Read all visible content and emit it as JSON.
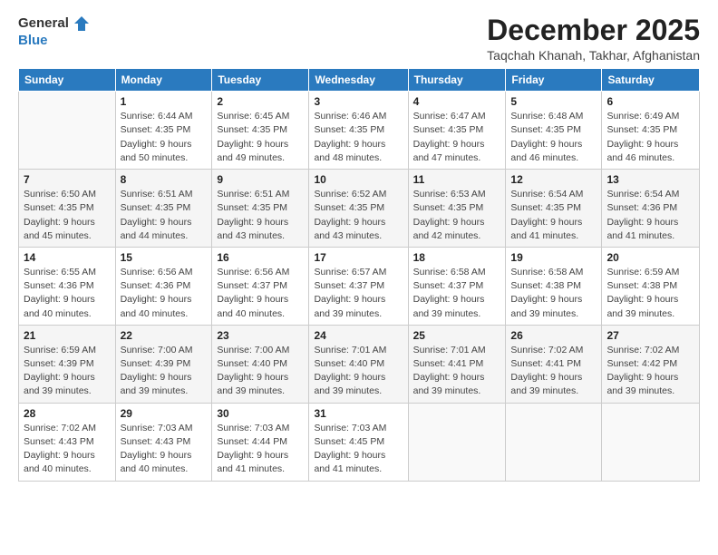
{
  "header": {
    "logo_general": "General",
    "logo_blue": "Blue",
    "month": "December 2025",
    "location": "Taqchah Khanah, Takhar, Afghanistan"
  },
  "weekdays": [
    "Sunday",
    "Monday",
    "Tuesday",
    "Wednesday",
    "Thursday",
    "Friday",
    "Saturday"
  ],
  "weeks": [
    [
      {
        "day": "",
        "info": ""
      },
      {
        "day": "1",
        "info": "Sunrise: 6:44 AM\nSunset: 4:35 PM\nDaylight: 9 hours\nand 50 minutes."
      },
      {
        "day": "2",
        "info": "Sunrise: 6:45 AM\nSunset: 4:35 PM\nDaylight: 9 hours\nand 49 minutes."
      },
      {
        "day": "3",
        "info": "Sunrise: 6:46 AM\nSunset: 4:35 PM\nDaylight: 9 hours\nand 48 minutes."
      },
      {
        "day": "4",
        "info": "Sunrise: 6:47 AM\nSunset: 4:35 PM\nDaylight: 9 hours\nand 47 minutes."
      },
      {
        "day": "5",
        "info": "Sunrise: 6:48 AM\nSunset: 4:35 PM\nDaylight: 9 hours\nand 46 minutes."
      },
      {
        "day": "6",
        "info": "Sunrise: 6:49 AM\nSunset: 4:35 PM\nDaylight: 9 hours\nand 46 minutes."
      }
    ],
    [
      {
        "day": "7",
        "info": "Sunrise: 6:50 AM\nSunset: 4:35 PM\nDaylight: 9 hours\nand 45 minutes."
      },
      {
        "day": "8",
        "info": "Sunrise: 6:51 AM\nSunset: 4:35 PM\nDaylight: 9 hours\nand 44 minutes."
      },
      {
        "day": "9",
        "info": "Sunrise: 6:51 AM\nSunset: 4:35 PM\nDaylight: 9 hours\nand 43 minutes."
      },
      {
        "day": "10",
        "info": "Sunrise: 6:52 AM\nSunset: 4:35 PM\nDaylight: 9 hours\nand 43 minutes."
      },
      {
        "day": "11",
        "info": "Sunrise: 6:53 AM\nSunset: 4:35 PM\nDaylight: 9 hours\nand 42 minutes."
      },
      {
        "day": "12",
        "info": "Sunrise: 6:54 AM\nSunset: 4:35 PM\nDaylight: 9 hours\nand 41 minutes."
      },
      {
        "day": "13",
        "info": "Sunrise: 6:54 AM\nSunset: 4:36 PM\nDaylight: 9 hours\nand 41 minutes."
      }
    ],
    [
      {
        "day": "14",
        "info": "Sunrise: 6:55 AM\nSunset: 4:36 PM\nDaylight: 9 hours\nand 40 minutes."
      },
      {
        "day": "15",
        "info": "Sunrise: 6:56 AM\nSunset: 4:36 PM\nDaylight: 9 hours\nand 40 minutes."
      },
      {
        "day": "16",
        "info": "Sunrise: 6:56 AM\nSunset: 4:37 PM\nDaylight: 9 hours\nand 40 minutes."
      },
      {
        "day": "17",
        "info": "Sunrise: 6:57 AM\nSunset: 4:37 PM\nDaylight: 9 hours\nand 39 minutes."
      },
      {
        "day": "18",
        "info": "Sunrise: 6:58 AM\nSunset: 4:37 PM\nDaylight: 9 hours\nand 39 minutes."
      },
      {
        "day": "19",
        "info": "Sunrise: 6:58 AM\nSunset: 4:38 PM\nDaylight: 9 hours\nand 39 minutes."
      },
      {
        "day": "20",
        "info": "Sunrise: 6:59 AM\nSunset: 4:38 PM\nDaylight: 9 hours\nand 39 minutes."
      }
    ],
    [
      {
        "day": "21",
        "info": "Sunrise: 6:59 AM\nSunset: 4:39 PM\nDaylight: 9 hours\nand 39 minutes."
      },
      {
        "day": "22",
        "info": "Sunrise: 7:00 AM\nSunset: 4:39 PM\nDaylight: 9 hours\nand 39 minutes."
      },
      {
        "day": "23",
        "info": "Sunrise: 7:00 AM\nSunset: 4:40 PM\nDaylight: 9 hours\nand 39 minutes."
      },
      {
        "day": "24",
        "info": "Sunrise: 7:01 AM\nSunset: 4:40 PM\nDaylight: 9 hours\nand 39 minutes."
      },
      {
        "day": "25",
        "info": "Sunrise: 7:01 AM\nSunset: 4:41 PM\nDaylight: 9 hours\nand 39 minutes."
      },
      {
        "day": "26",
        "info": "Sunrise: 7:02 AM\nSunset: 4:41 PM\nDaylight: 9 hours\nand 39 minutes."
      },
      {
        "day": "27",
        "info": "Sunrise: 7:02 AM\nSunset: 4:42 PM\nDaylight: 9 hours\nand 39 minutes."
      }
    ],
    [
      {
        "day": "28",
        "info": "Sunrise: 7:02 AM\nSunset: 4:43 PM\nDaylight: 9 hours\nand 40 minutes."
      },
      {
        "day": "29",
        "info": "Sunrise: 7:03 AM\nSunset: 4:43 PM\nDaylight: 9 hours\nand 40 minutes."
      },
      {
        "day": "30",
        "info": "Sunrise: 7:03 AM\nSunset: 4:44 PM\nDaylight: 9 hours\nand 41 minutes."
      },
      {
        "day": "31",
        "info": "Sunrise: 7:03 AM\nSunset: 4:45 PM\nDaylight: 9 hours\nand 41 minutes."
      },
      {
        "day": "",
        "info": ""
      },
      {
        "day": "",
        "info": ""
      },
      {
        "day": "",
        "info": ""
      }
    ]
  ]
}
